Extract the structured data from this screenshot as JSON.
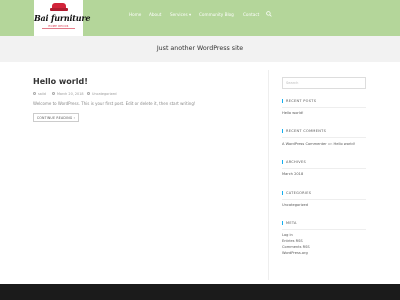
{
  "header": {
    "logo_text": "Bai furniture",
    "logo_tagline": "HOME DECOR",
    "nav": [
      {
        "label": "Home"
      },
      {
        "label": "About"
      },
      {
        "label": "Services"
      },
      {
        "label": "Community Blog"
      },
      {
        "label": "Contact"
      }
    ],
    "colors": {
      "header_bg": "#b4d69a",
      "accent": "#13aff0",
      "footer_bg": "#1b1b1b"
    }
  },
  "banner": {
    "title": "Just another WordPress site"
  },
  "post": {
    "title": "Hello world!",
    "author": "saiid",
    "date": "March 20, 2018",
    "category": "Uncategorized",
    "excerpt": "Welcome to WordPress. This is your first post. Edit or delete it, then start writing!",
    "button_label": "CONTINUE READING"
  },
  "sidebar": {
    "search_placeholder": "Search",
    "recent_posts": {
      "title": "RECENT POSTS",
      "items": [
        "Hello world!"
      ]
    },
    "recent_comments": {
      "title": "RECENT COMMENTS",
      "items": [
        {
          "author": "A WordPress Commenter",
          "on": "on",
          "post": "Hello world!"
        }
      ]
    },
    "archives": {
      "title": "ARCHIVES",
      "items": [
        "March 2018"
      ]
    },
    "categories": {
      "title": "CATEGORIES",
      "items": [
        "Uncategorized"
      ]
    },
    "meta": {
      "title": "META",
      "items": [
        "Log in",
        "Entries RSS",
        "Comments RSS",
        "WordPress.org"
      ]
    }
  }
}
